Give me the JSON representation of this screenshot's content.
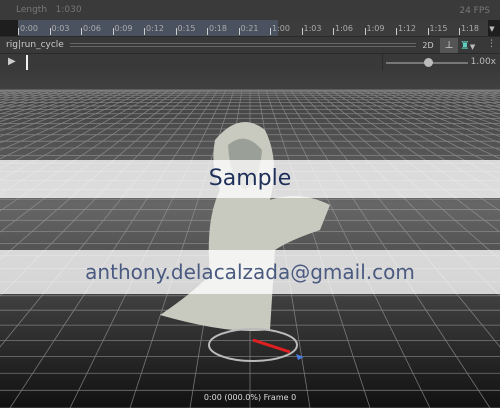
{
  "header": {
    "length_label": "Length",
    "length_value": "1:030",
    "fps": "24 FPS"
  },
  "timeline": {
    "ticks": [
      "0:00",
      "0:03",
      "0:06",
      "0:09",
      "0:12",
      "0:15",
      "0:18",
      "0:21",
      "1:00",
      "1:03",
      "1:06",
      "1:09",
      "1:12",
      "1:15",
      "1:18"
    ]
  },
  "toolbar": {
    "rig": "rig",
    "clip": "run_cycle",
    "mode_2d": "2D",
    "speed": "1.00x",
    "speed_fraction": 0.5
  },
  "watermark": {
    "title": "Sample",
    "email": "anthony.delacalzada@gmail.com"
  },
  "status": "0:00 (000.0%) Frame 0"
}
